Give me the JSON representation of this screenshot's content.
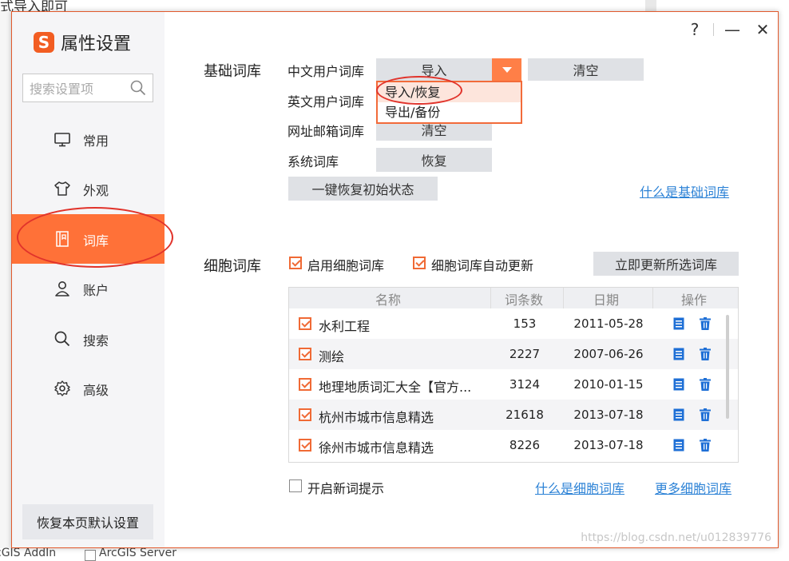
{
  "background": {
    "top_text": "式导入即可",
    "bottom_left_text": "cGIS AddIn",
    "bottom_right_text": "ArcGIS Server"
  },
  "window": {
    "title": "属性设置",
    "logo_letter": "S",
    "title_buttons": {
      "help": "?",
      "minimize": "—",
      "close": "✕"
    }
  },
  "sidebar": {
    "search_placeholder": "搜索设置项",
    "items": [
      {
        "label": "常用",
        "icon": "monitor-icon"
      },
      {
        "label": "外观",
        "icon": "shirt-icon"
      },
      {
        "label": "词库",
        "icon": "book-icon",
        "active": true
      },
      {
        "label": "账户",
        "icon": "user-icon"
      },
      {
        "label": "搜索",
        "icon": "search-icon"
      },
      {
        "label": "高级",
        "icon": "gear-icon"
      }
    ],
    "restore_default": "恢复本页默认设置"
  },
  "basic": {
    "section_label": "基础词库",
    "rows": [
      {
        "label": "中文用户词库",
        "btn1": "导入",
        "btn2": "清空"
      },
      {
        "label": "英文用户词库"
      },
      {
        "label": "网址邮箱词库",
        "btn1": "清空"
      },
      {
        "label": "系统词库",
        "btn1": "恢复"
      }
    ],
    "dropdown_items": [
      "导入/恢复",
      "导出/备份"
    ],
    "reset_all": "一键恢复初始状态",
    "help_link": "什么是基础词库"
  },
  "cell": {
    "section_label": "细胞词库",
    "enable_label": "启用细胞词库",
    "auto_update_label": "细胞词库自动更新",
    "update_now": "立即更新所选词库",
    "table": {
      "headers": [
        "名称",
        "词条数",
        "日期",
        "操作"
      ],
      "rows": [
        {
          "name": "水利工程",
          "count": "153",
          "date": "2011-05-28"
        },
        {
          "name": "测绘",
          "count": "2227",
          "date": "2007-06-26"
        },
        {
          "name": "地理地质词汇大全【官方...",
          "count": "3124",
          "date": "2010-01-15"
        },
        {
          "name": "杭州市城市信息精选",
          "count": "21618",
          "date": "2013-07-18"
        },
        {
          "name": "徐州市城市信息精选",
          "count": "8226",
          "date": "2013-07-18"
        }
      ]
    },
    "new_word_tip": "开启新词提示",
    "what_is_link": "什么是细胞词库",
    "more_link": "更多细胞词库"
  },
  "watermark": "https://blog.csdn.net/u012839776",
  "colors": {
    "accent": "#ff7138",
    "link": "#2c82d6",
    "annotation": "#e1332b"
  }
}
